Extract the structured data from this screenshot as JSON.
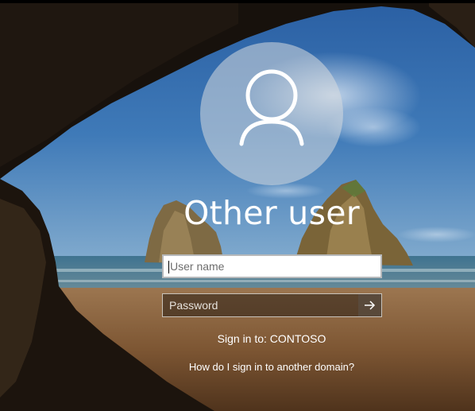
{
  "login": {
    "title": "Other user",
    "username_placeholder": "User name",
    "password_placeholder": "Password",
    "submit_icon": "arrow-right-icon",
    "sign_in_to": "Sign in to: CONTOSO",
    "domain_help_link": "How do I sign in to another domain?"
  },
  "colors": {
    "title_text": "#ffffff",
    "avatar_circle": "#d7dade",
    "input_border": "#b7b9bb"
  }
}
